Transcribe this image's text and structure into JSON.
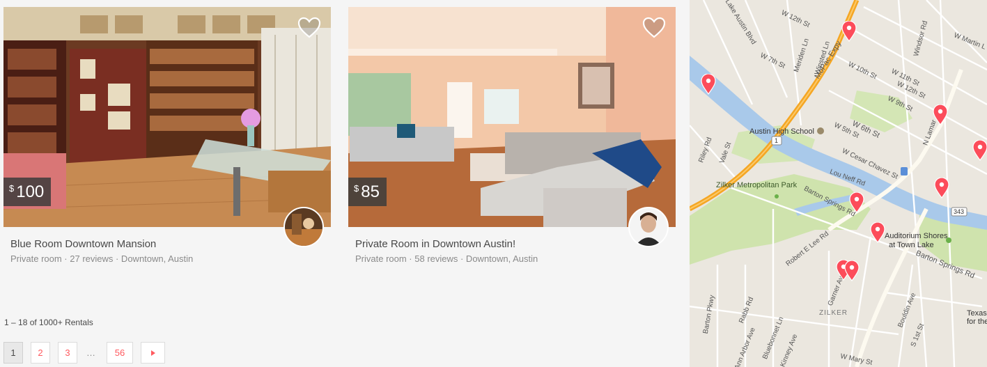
{
  "listings": [
    {
      "currency": "$",
      "price": "100",
      "title": "Blue Room Downtown Mansion",
      "meta": "Private room · 27 reviews · Downtown, Austin"
    },
    {
      "currency": "$",
      "price": "85",
      "title": "Private Room in Downtown Austin!",
      "meta": "Private room · 58 reviews · Downtown, Austin"
    }
  ],
  "results": {
    "count": "1 – 18 of 1000+ Rentals"
  },
  "pagination": {
    "pages": [
      "1",
      "2",
      "3"
    ],
    "ellipsis": "…",
    "last": "56",
    "current": "1",
    "next_icon": "triangle-right-icon"
  },
  "map": {
    "labels": {
      "austin_high": "Austin High School",
      "zilker_park": "Zilker Metropolitan Park",
      "barton_springs": "Barton Springs Rd",
      "barton_springs_2": "Barton Springs Rd",
      "auditorium": "Auditorium Shores",
      "auditorium_2": "at Town Lake",
      "mopac": "MoPac Expy",
      "cesar_chavez": "W Cesar Chavez St",
      "lamar": "N Lamar",
      "w6th": "W 6th St",
      "w5th": "W 5th St",
      "w10th": "W 10th St",
      "w12th": "W 12th St",
      "w12th_b": "W 12th St",
      "w11th": "W 11th St",
      "w9th": "W 9th St",
      "w7th": "W 7th St",
      "zilker": "ZILKER",
      "lou_neff": "Lou Neff Rd",
      "robert_lee": "Robert E Lee Rd",
      "riley": "Riley Rd",
      "vale": "Vale St",
      "garner": "Garner Ave",
      "bouldin": "Bouldin Ave",
      "s1st": "S 1st St",
      "rabb": "Rabb Rd",
      "barton_pkwy": "Barton Pkwy",
      "ann_arbor": "Ann Arbor Ave",
      "bluebonnet": "Bluebonnet Ln",
      "kinney": "Kinney Ave",
      "lake_austin": "Lake Austin Blvd",
      "winsted": "Winsted Ln",
      "meriden": "Meriden Ln",
      "w_martin": "W Martin L",
      "windsor": "Windsor Rd",
      "w_mary": "W Mary St",
      "texas": "Texas",
      "texas_2": "for the",
      "hwy1": "1",
      "hwy343": "343"
    },
    "colors": {
      "park": "#c9dfa8",
      "water": "#a8c8e8",
      "freeway": "#f5a623",
      "marker": "#fc4c5a"
    }
  }
}
